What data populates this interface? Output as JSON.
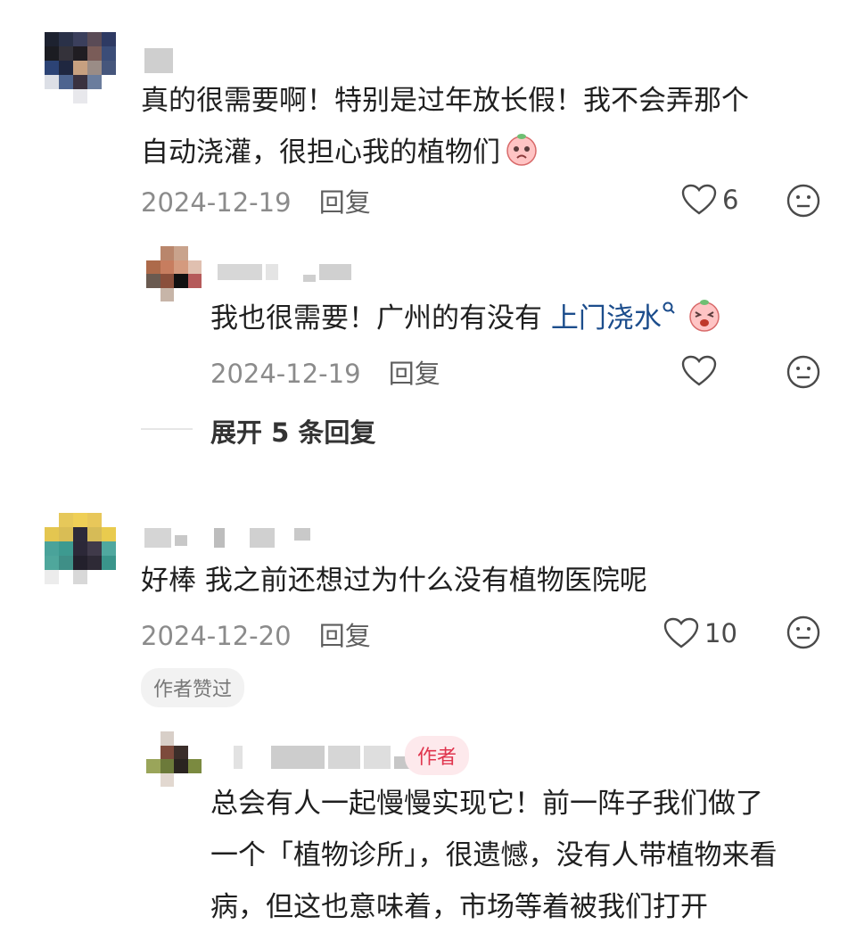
{
  "comments": [
    {
      "text_line1": "真的很需要啊！特别是过年放长假！我不会弄那个",
      "text_line2": "自动浇灌，很担心我的植物们",
      "date": "2024-12-19",
      "reply_label": "回复",
      "likes": "6",
      "reply": {
        "text_before_link": "我也很需要！广州的有没有 ",
        "link_text": "上门浇水",
        "date": "2024-12-19",
        "reply_label": "回复"
      },
      "expand_label": "展开 5 条回复"
    },
    {
      "text": "好棒 我之前还想过为什么没有植物医院呢",
      "date": "2024-12-20",
      "reply_label": "回复",
      "likes": "10",
      "author_liked_badge": "作者赞过",
      "reply": {
        "author_badge": "作者",
        "text_line1": "总会有人一起慢慢实现它！前一阵子我们做了",
        "text_line2": "一个「植物诊所」，很遗憾，没有人带植物来看",
        "text_line3": "病，但这也意味着，市场等着被我们打开"
      }
    }
  ],
  "icons": {
    "like": "heart-outline-icon",
    "dislike": "neutral-face-icon",
    "search_hint": "search-small-icon",
    "emoji_worried": "peach-worried-emoji",
    "emoji_scream": "peach-scream-emoji"
  },
  "colors": {
    "link": "#1c4d8c",
    "author_badge_text": "#e0354e",
    "author_badge_bg": "#fde9ec",
    "meta_gray": "#8b8b8b"
  }
}
